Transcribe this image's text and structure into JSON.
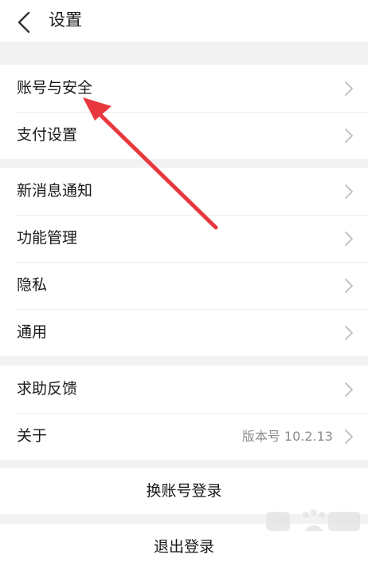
{
  "header": {
    "title": "设置"
  },
  "groups": [
    {
      "items": [
        {
          "label": "账号与安全"
        },
        {
          "label": "支付设置"
        }
      ]
    },
    {
      "items": [
        {
          "label": "新消息通知"
        },
        {
          "label": "功能管理"
        },
        {
          "label": "隐私"
        },
        {
          "label": "通用"
        }
      ]
    },
    {
      "items": [
        {
          "label": "求助反馈"
        },
        {
          "label": "关于",
          "value": "版本号 10.2.13"
        }
      ]
    }
  ],
  "actions": {
    "switch_account": "换账号登录",
    "logout": "退出登录"
  },
  "colors": {
    "background": "#f2f2f2",
    "surface": "#ffffff",
    "annotation_arrow": "#e8383d"
  },
  "watermark": {
    "text": "Baidu 经验"
  }
}
